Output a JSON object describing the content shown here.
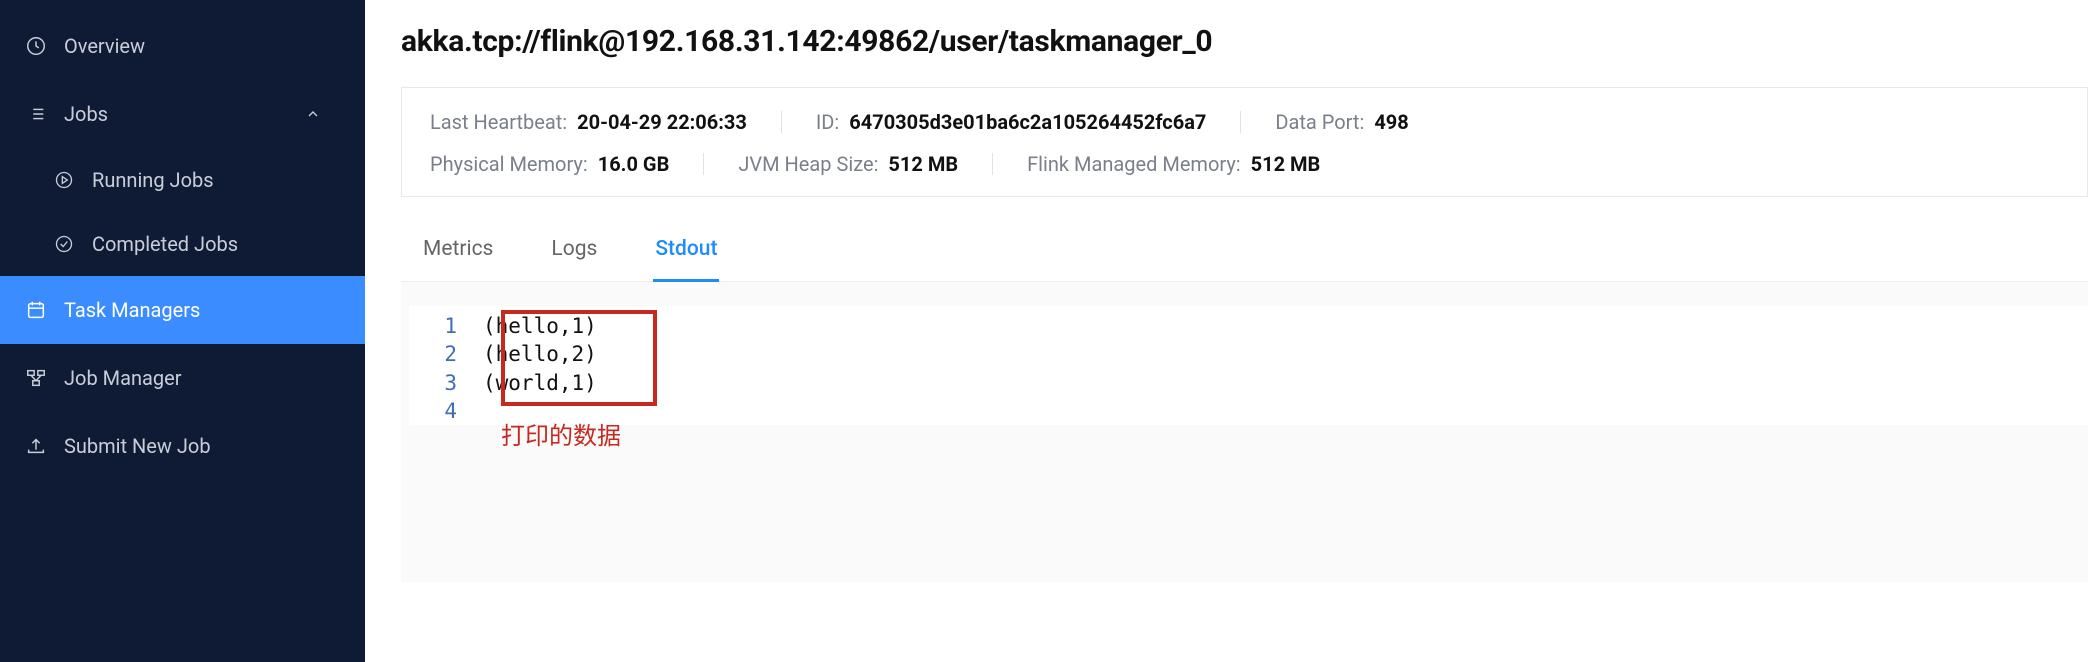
{
  "sidebar": {
    "overview": "Overview",
    "jobs": "Jobs",
    "running_jobs": "Running Jobs",
    "completed_jobs": "Completed Jobs",
    "task_managers": "Task Managers",
    "job_manager": "Job Manager",
    "submit_new_job": "Submit New Job"
  },
  "page": {
    "title": "akka.tcp://flink@192.168.31.142:49862/user/taskmanager_0"
  },
  "info": {
    "last_heartbeat_label": "Last Heartbeat:",
    "last_heartbeat_value": "20-04-29 22:06:33",
    "id_label": "ID:",
    "id_value": "6470305d3e01ba6c2a105264452fc6a7",
    "data_port_label": "Data Port:",
    "data_port_value": "498",
    "physical_memory_label": "Physical Memory:",
    "physical_memory_value": "16.0 GB",
    "jvm_heap_label": "JVM Heap Size:",
    "jvm_heap_value": "512 MB",
    "flink_managed_label": "Flink Managed Memory:",
    "flink_managed_value": "512 MB"
  },
  "tabs": {
    "metrics": "Metrics",
    "logs": "Logs",
    "stdout": "Stdout"
  },
  "stdout_lines": [
    "(hello,1)",
    "(hello,2)",
    "(world,1)",
    ""
  ],
  "line_numbers": [
    "1",
    "2",
    "3",
    "4"
  ],
  "annotation": "打印的数据"
}
